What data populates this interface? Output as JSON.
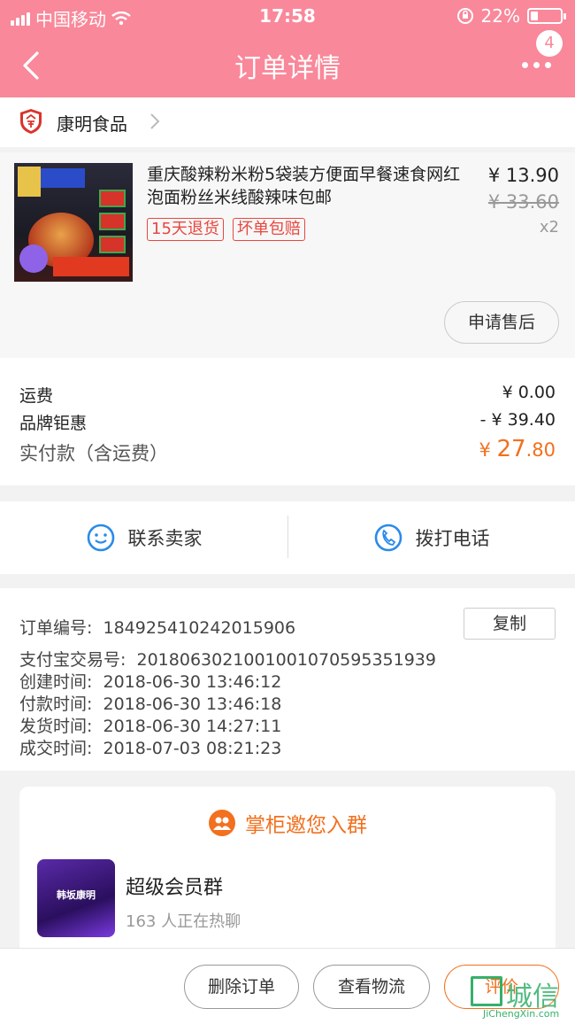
{
  "status_bar": {
    "carrier": "中国移动",
    "time": "17:58",
    "battery": "22%",
    "battery_level": 0.22
  },
  "nav": {
    "title": "订单详情",
    "more_badge": "4"
  },
  "shop": {
    "name": "康明食品"
  },
  "product": {
    "title": "重庆酸辣粉米粉5袋装方便面早餐速食网红泡面粉丝米线酸辣味包邮",
    "price": "¥ 13.90",
    "original_price": "¥ 33.60",
    "quantity": "x2",
    "tags": [
      "15天退货",
      "坏单包赔"
    ],
    "after_sale_label": "申请售后",
    "image_text": {
      "corner": "超值",
      "pack_title": "组合装",
      "weight": "526g/5袋",
      "banner": "拍两份加送1袋"
    }
  },
  "fees": {
    "shipping_label": "运费",
    "shipping_value": "¥ 0.00",
    "discount_label": "品牌钜惠",
    "discount_value": "- ¥ 39.40",
    "total_label": "实付款（含运费）",
    "total_currency": "¥",
    "total_int": "27",
    "total_dec": ".80"
  },
  "contact": {
    "seller_label": "联系卖家",
    "call_label": "拨打电话"
  },
  "order_info": {
    "order_no_label": "订单编号:",
    "order_no": "184925410242015906",
    "copy_label": "复制",
    "alipay_label": "支付宝交易号:",
    "alipay_no": "2018063021001001070595351939",
    "created_label": "创建时间:",
    "created": "2018-06-30 13:46:12",
    "paid_label": "付款时间:",
    "paid": "2018-06-30 13:46:18",
    "shipped_label": "发货时间:",
    "shipped": "2018-06-30 14:27:11",
    "completed_label": "成交时间:",
    "completed": "2018-07-03 08:21:23"
  },
  "group": {
    "header": "掌柜邀您入群",
    "name": "超级会员群",
    "count": "163 人正在热聊",
    "logo_text": "韩坂康明"
  },
  "bottom_bar": {
    "delete_label": "删除订单",
    "logistics_label": "查看物流",
    "review_label": "评价"
  },
  "watermark": {
    "text": "城信",
    "url": "JiChengXin.com"
  },
  "colors": {
    "header_bg": "#f9889a",
    "accent_orange": "#f2701e",
    "tag_red": "#e8473f",
    "watermark_green": "#35b06a"
  }
}
